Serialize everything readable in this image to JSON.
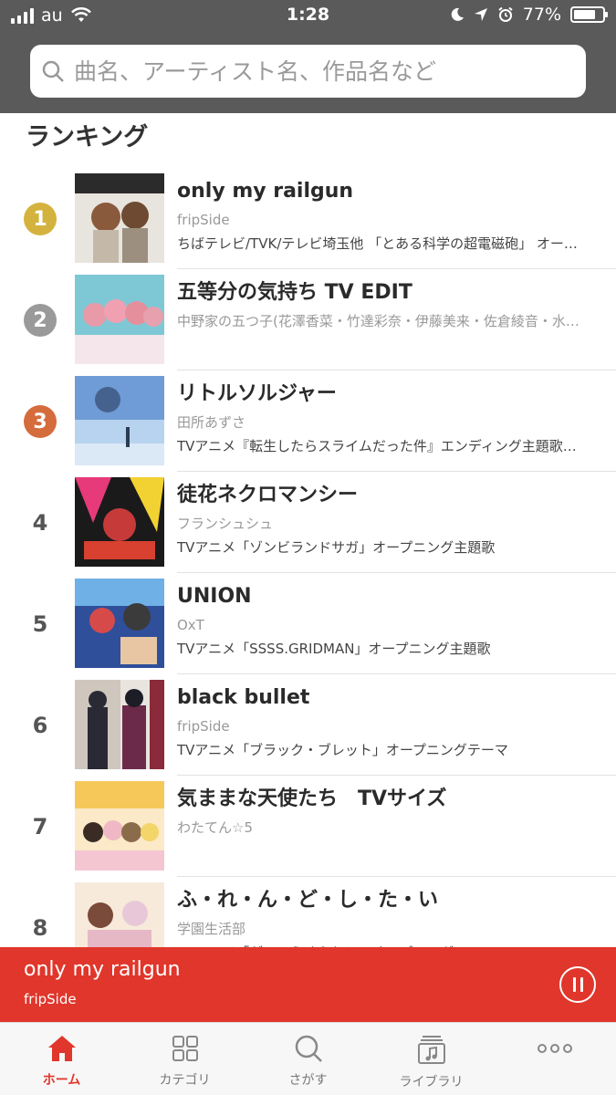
{
  "status_bar": {
    "carrier": "au",
    "time": "1:28",
    "battery": "77%"
  },
  "search": {
    "placeholder": "曲名、アーティスト名、作品名など"
  },
  "section_title": "ランキング",
  "ranking": [
    {
      "rank": "1",
      "medal_color": "#d4b23e",
      "title": "only my railgun",
      "artist": "fripSide",
      "desc": "ちばテレビ/TVK/テレビ埼玉他 「とある科学の超電磁砲」 オー…"
    },
    {
      "rank": "2",
      "medal_color": "#9a9a9a",
      "title": "五等分の気持ち TV EDIT",
      "artist": "中野家の五つ子(花澤香菜・竹達彩奈・伊藤美来・佐倉綾音・水…",
      "desc": ""
    },
    {
      "rank": "3",
      "medal_color": "#d56c3c",
      "title": "リトルソルジャー",
      "artist": "田所あずさ",
      "desc": "TVアニメ『転生したらスライムだった件』エンディング主題歌…"
    },
    {
      "rank": "4",
      "medal_color": "",
      "title": "徒花ネクロマンシー",
      "artist": "フランシュシュ",
      "desc": "TVアニメ「ゾンビランドサガ」オープニング主題歌"
    },
    {
      "rank": "5",
      "medal_color": "",
      "title": "UNION",
      "artist": "OxT",
      "desc": "TVアニメ「SSSS.GRIDMAN」オープニング主題歌"
    },
    {
      "rank": "6",
      "medal_color": "",
      "title": "black bullet",
      "artist": "fripSide",
      "desc": "TVアニメ「ブラック・ブレット」オープニングテーマ"
    },
    {
      "rank": "7",
      "medal_color": "",
      "title": "気ままな天使たち　TVサイズ",
      "artist": "わたてん☆5",
      "desc": ""
    },
    {
      "rank": "8",
      "medal_color": "",
      "title": "ふ・れ・ん・ど・し・た・い",
      "artist": "学園生活部",
      "desc": "TVアニメ「がっこうぐらし！」オープニングテーマ"
    }
  ],
  "now_playing": {
    "title": "only my railgun",
    "artist": "fripSide"
  },
  "tabs": [
    {
      "label": "ホーム",
      "icon": "home-icon",
      "active": true
    },
    {
      "label": "カテゴリ",
      "icon": "grid-icon",
      "active": false
    },
    {
      "label": "さがす",
      "icon": "search-icon",
      "active": false
    },
    {
      "label": "ライブラリ",
      "icon": "library-icon",
      "active": false
    },
    {
      "label": "",
      "icon": "more-icon",
      "active": false
    }
  ],
  "colors": {
    "accent": "#e0362b",
    "header_bg": "#5a5a5a"
  }
}
